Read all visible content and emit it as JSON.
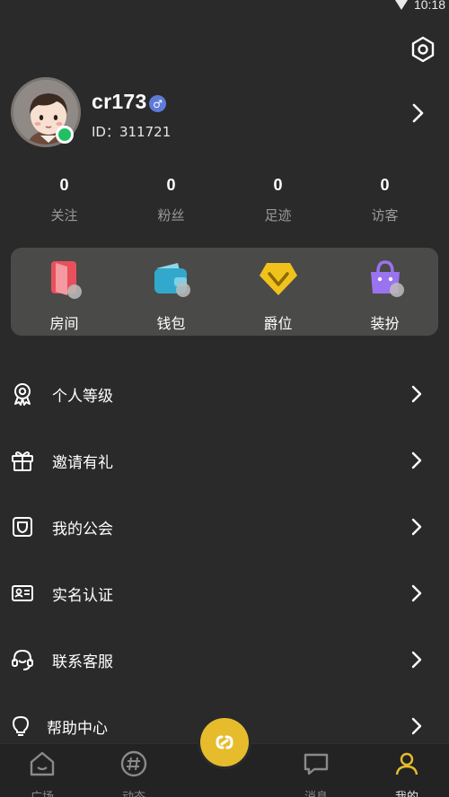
{
  "status_bar": {
    "time": "10:18"
  },
  "profile": {
    "username": "cr173",
    "gender_symbol": "♂",
    "id_text": "ID：311721",
    "online": true
  },
  "stats": [
    {
      "value": "0",
      "label": "关注"
    },
    {
      "value": "0",
      "label": "粉丝"
    },
    {
      "value": "0",
      "label": "足迹"
    },
    {
      "value": "0",
      "label": "访客"
    }
  ],
  "quick_actions": [
    {
      "label": "房间",
      "icon": "room-icon"
    },
    {
      "label": "钱包",
      "icon": "wallet-icon"
    },
    {
      "label": "爵位",
      "icon": "nobility-icon"
    },
    {
      "label": "装扮",
      "icon": "dressup-icon"
    }
  ],
  "menu": [
    {
      "label": "个人等级",
      "icon": "medal-icon"
    },
    {
      "label": "邀请有礼",
      "icon": "gift-icon"
    },
    {
      "label": "我的公会",
      "icon": "guild-icon"
    },
    {
      "label": "实名认证",
      "icon": "id-card-icon"
    },
    {
      "label": "联系客服",
      "icon": "headset-icon"
    },
    {
      "label": "帮助中心",
      "icon": "lightbulb-icon"
    }
  ],
  "bottom_nav": [
    {
      "label": "广场",
      "icon": "home-icon"
    },
    {
      "label": "动态",
      "icon": "hashtag-icon"
    },
    {
      "label": "消息",
      "icon": "message-icon"
    },
    {
      "label": "我的",
      "icon": "profile-icon",
      "active": true
    }
  ],
  "colors": {
    "background": "#2a2a2a",
    "panel": "#4a4a49",
    "accent_yellow": "#e6bc2d",
    "online_green": "#21c065",
    "gender_blue": "#5e7bd9"
  }
}
